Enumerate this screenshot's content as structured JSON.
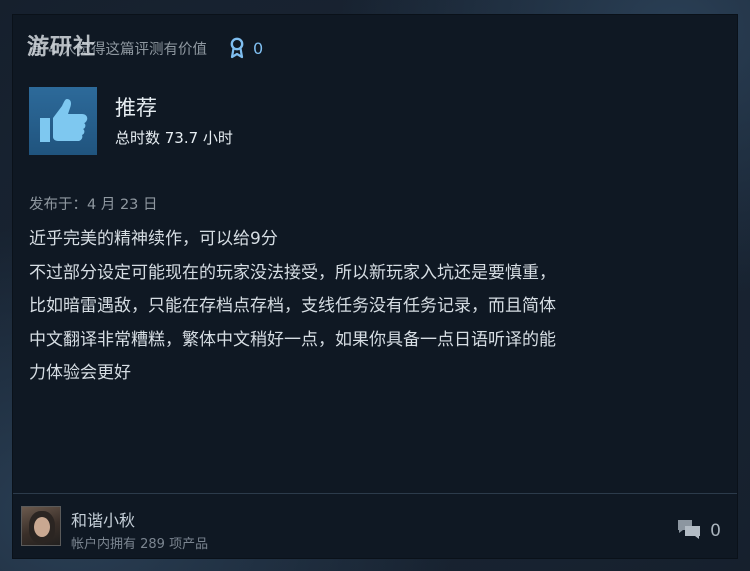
{
  "helpful": {
    "text": "有 4 人觉得这篇评测有价值",
    "award_count": "0"
  },
  "watermark": "游研社",
  "verdict": {
    "title": "推荐",
    "hours": "总时数 73.7 小时"
  },
  "posted": "发布于：4 月 23 日",
  "review_lines": [
    "近乎完美的精神续作，可以给9分",
    "不过部分设定可能现在的玩家没法接受，所以新玩家入坑还是要慎重，",
    "比如暗雷遇敌，只能在存档点存档，支线任务没有任务记录，而且简体",
    "中文翻译非常糟糕，繁体中文稍好一点，如果你具备一点日语听译的能",
    "力体验会更好"
  ],
  "author": {
    "name": "和谐小秋",
    "products": "帐户内拥有 289 项产品"
  },
  "comments": {
    "count": "0"
  },
  "icons": {
    "thumb": "thumbs-up-icon",
    "award": "award-ribbon-icon",
    "comment": "comment-bubbles-icon"
  },
  "colors": {
    "thumb_bg": "#2d6a9a",
    "award": "#7fbef0",
    "card_bg": "#0f1823"
  }
}
